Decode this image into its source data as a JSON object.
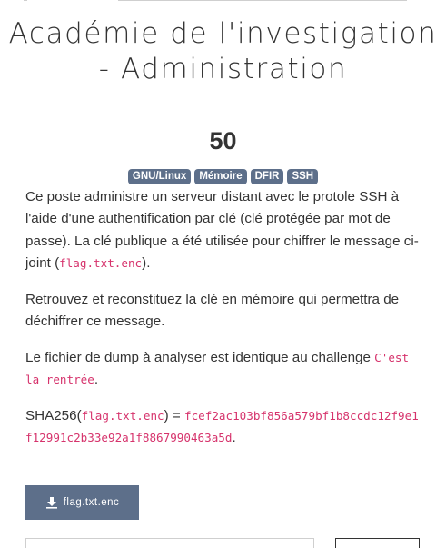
{
  "challenge": {
    "title": "Académie de l'investigation - Administration",
    "points": "50",
    "tags": [
      "GNU/Linux",
      "Mémoire",
      "DFIR",
      "SSH"
    ]
  },
  "description": {
    "p1_text": "Ce poste administre un serveur distant avec le protole SSH à l'aide d'une authentification par clé (clé protégée par mot de passe). La clé publique a été utilisée pour chiffrer le message ci-joint (",
    "p1_code": "flag.txt.enc",
    "p1_end": ").",
    "p2": "Retrouvez et reconstituez la clé en mémoire qui permettra de déchiffrer ce message.",
    "p3_text": "Le fichier de dump à analyser est identique au challenge ",
    "p3_code": "C'est la rentrée",
    "p3_end": ".",
    "sha_label": "SHA256(",
    "sha_file": "flag.txt.enc",
    "sha_eq": ") = ",
    "sha_hash": "fcef2ac103bf856a579bf1b8ccdc12f9e1f12991c2b33e92a1f8867990463a5d",
    "sha_end": "."
  },
  "download": {
    "label": "flag.txt.enc",
    "icon": "download-icon"
  }
}
